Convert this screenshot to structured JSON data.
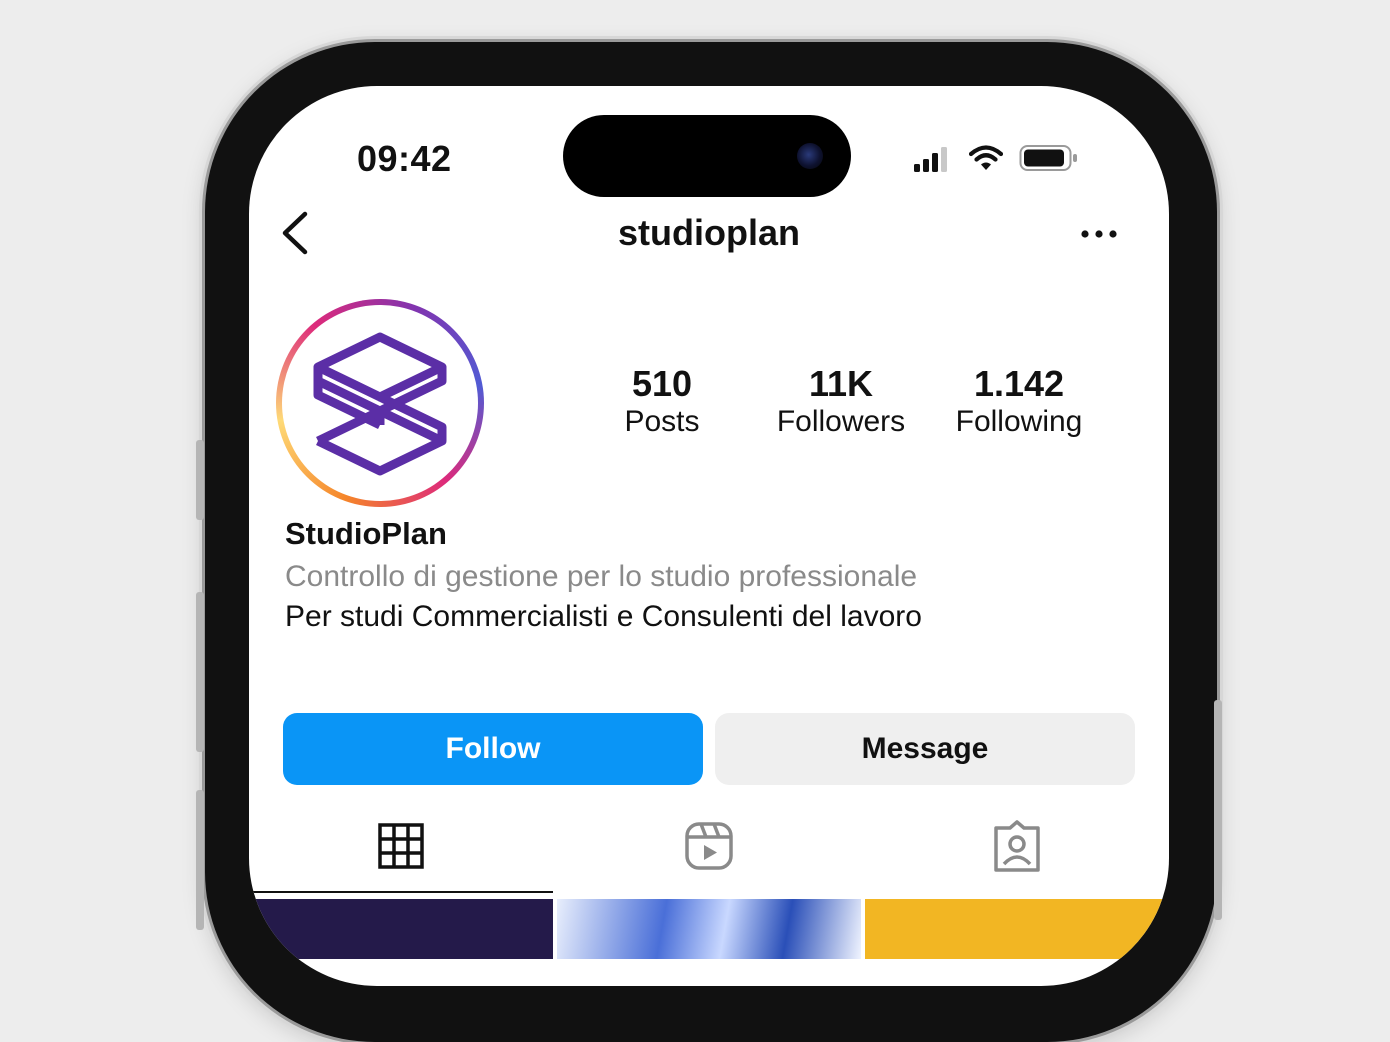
{
  "status_bar": {
    "time": "09:42"
  },
  "header": {
    "username": "studioplan"
  },
  "profile": {
    "display_name": "StudioPlan",
    "bio_category": "Controllo di gestione per lo studio professionale",
    "bio_text": "Per studi Commercialisti e Consulenti del lavoro",
    "stats": [
      {
        "value": "510",
        "label": "Posts"
      },
      {
        "value": "11K",
        "label": "Followers"
      },
      {
        "value": "1.142",
        "label": "Following"
      }
    ]
  },
  "actions": {
    "follow_label": "Follow",
    "message_label": "Message"
  },
  "tabs": [
    {
      "icon": "grid-icon"
    },
    {
      "icon": "reels-icon"
    },
    {
      "icon": "tagged-icon"
    }
  ],
  "colors": {
    "follow_button": "#0a95f6",
    "message_button": "#efefef",
    "logo_purple": "#5b2ea6",
    "background": "#ededed"
  }
}
